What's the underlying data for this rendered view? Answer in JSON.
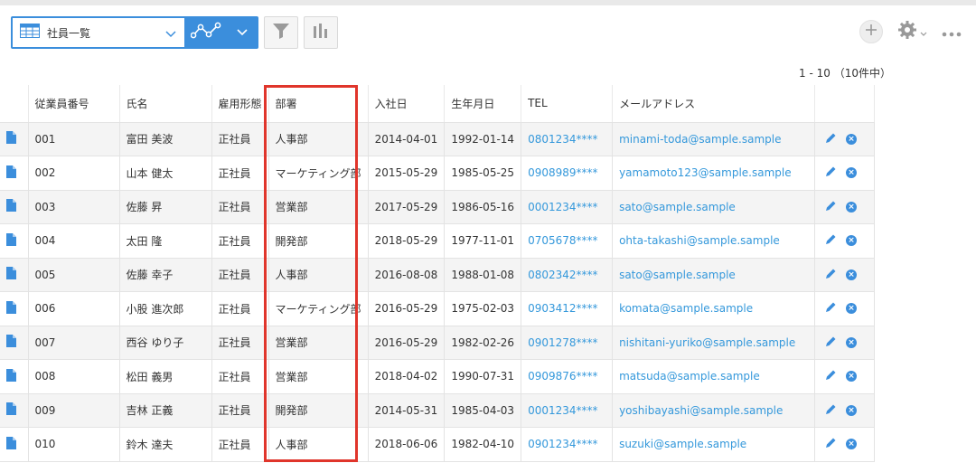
{
  "toolbar": {
    "view_name": "社員一覧",
    "icons": [
      "table-icon",
      "chevron-down-icon",
      "graph-icon",
      "filter-icon",
      "chart-icon",
      "plus-icon",
      "gear-icon",
      "more-icon"
    ]
  },
  "pager": {
    "text": "1 - 10 （10件中）"
  },
  "columns": [
    "従業員番号",
    "氏名",
    "雇用形態",
    "部署",
    "入社日",
    "生年月日",
    "TEL",
    "メールアドレス"
  ],
  "rows": [
    {
      "id": "001",
      "name": "富田 美波",
      "type": "正社員",
      "dept": "人事部",
      "joined": "2014-04-01",
      "birth": "1992-01-14",
      "tel": "0801234****",
      "email": "minami-toda@sample.sample"
    },
    {
      "id": "002",
      "name": "山本 健太",
      "type": "正社員",
      "dept": "マーケティング部",
      "joined": "2015-05-29",
      "birth": "1985-05-25",
      "tel": "0908989****",
      "email": "yamamoto123@sample.sample"
    },
    {
      "id": "003",
      "name": "佐藤 昇",
      "type": "正社員",
      "dept": "営業部",
      "joined": "2017-05-29",
      "birth": "1986-05-16",
      "tel": "0001234****",
      "email": "sato@sample.sample"
    },
    {
      "id": "004",
      "name": "太田 隆",
      "type": "正社員",
      "dept": "開発部",
      "joined": "2018-05-29",
      "birth": "1977-11-01",
      "tel": "0705678****",
      "email": "ohta-takashi@sample.sample"
    },
    {
      "id": "005",
      "name": "佐藤 幸子",
      "type": "正社員",
      "dept": "人事部",
      "joined": "2016-08-08",
      "birth": "1988-01-08",
      "tel": "0802342****",
      "email": "sato@sample.sample"
    },
    {
      "id": "006",
      "name": "小股 進次郎",
      "type": "正社員",
      "dept": "マーケティング部",
      "joined": "2016-05-29",
      "birth": "1975-02-03",
      "tel": "0903412****",
      "email": "komata@sample.sample"
    },
    {
      "id": "007",
      "name": "西谷 ゆり子",
      "type": "正社員",
      "dept": "営業部",
      "joined": "2016-05-29",
      "birth": "1982-02-26",
      "tel": "0901278****",
      "email": "nishitani-yuriko@sample.sample"
    },
    {
      "id": "008",
      "name": "松田 義男",
      "type": "正社員",
      "dept": "営業部",
      "joined": "2018-04-02",
      "birth": "1990-07-31",
      "tel": "0909876****",
      "email": "matsuda@sample.sample"
    },
    {
      "id": "009",
      "name": "吉林 正義",
      "type": "正社員",
      "dept": "開発部",
      "joined": "2014-05-31",
      "birth": "1985-04-03",
      "tel": "0001234****",
      "email": "yoshibayashi@sample.sample"
    },
    {
      "id": "010",
      "name": "鈴木 達夫",
      "type": "正社員",
      "dept": "人事部",
      "joined": "2018-06-06",
      "birth": "1982-04-10",
      "tel": "0901234****",
      "email": "suzuki@sample.sample"
    }
  ],
  "colors": {
    "accent": "#3b8edc",
    "link": "#3498db",
    "highlight": "#e0352b"
  }
}
